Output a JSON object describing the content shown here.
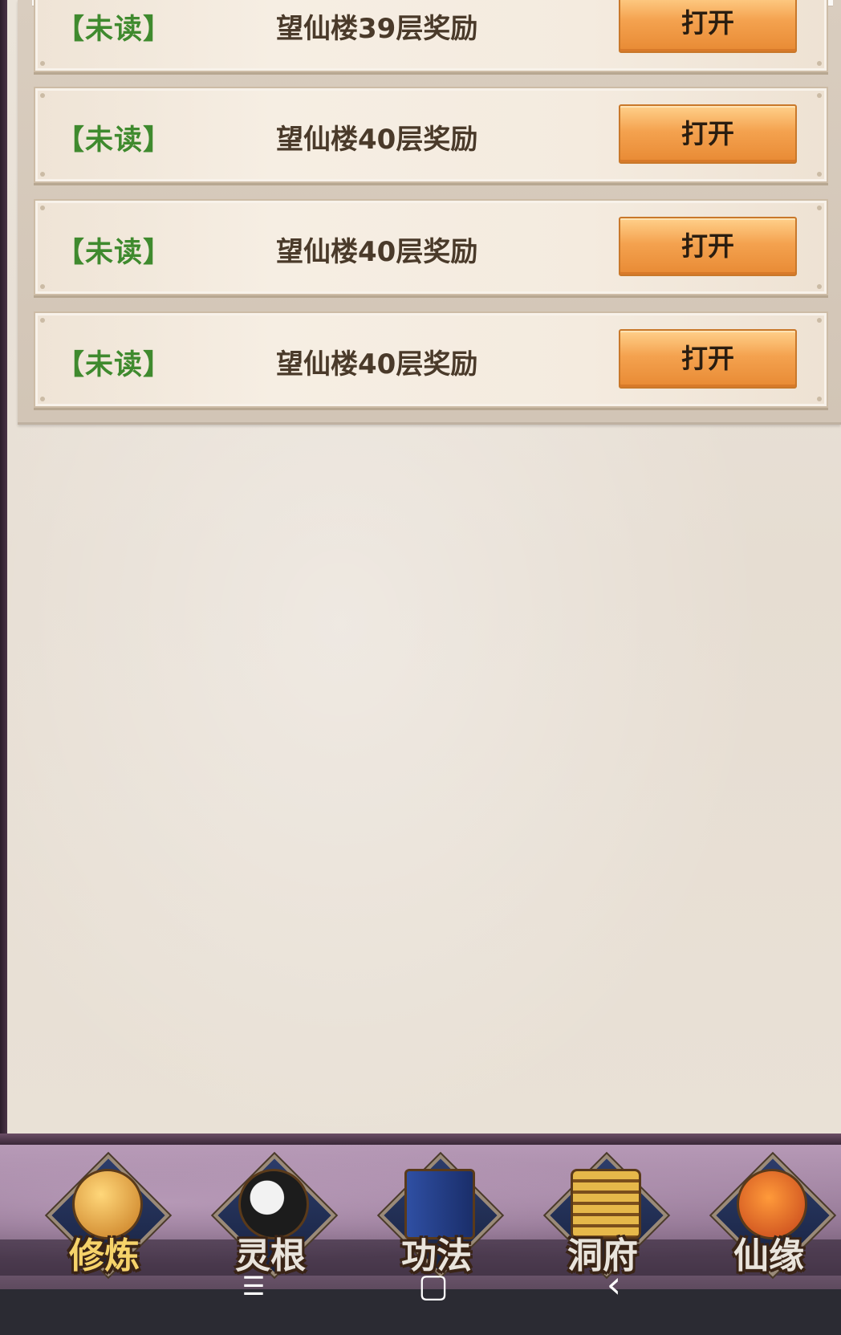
{
  "mail_list": {
    "items": [
      {
        "status": "【未读】",
        "title": "望仙楼39层奖励",
        "button": "打开"
      },
      {
        "status": "【未读】",
        "title": "望仙楼40层奖励",
        "button": "打开"
      },
      {
        "status": "【未读】",
        "title": "望仙楼40层奖励",
        "button": "打开"
      },
      {
        "status": "【未读】",
        "title": "望仙楼40层奖励",
        "button": "打开"
      }
    ]
  },
  "bottom_nav": {
    "items": [
      {
        "label": "修炼",
        "icon": "monk-icon"
      },
      {
        "label": "灵根",
        "icon": "yin-yang-sword-icon"
      },
      {
        "label": "功法",
        "icon": "book-icon"
      },
      {
        "label": "洞府",
        "icon": "pagoda-icon"
      },
      {
        "label": "仙缘",
        "icon": "gourd-icon"
      }
    ]
  },
  "system_bar": {
    "menu": "☰",
    "home": "▢",
    "back": "‹"
  },
  "colors": {
    "unread_status": "#3f8a2e",
    "button_orange": "#f4a24f",
    "nav_label_gold": "#f6d36a"
  }
}
